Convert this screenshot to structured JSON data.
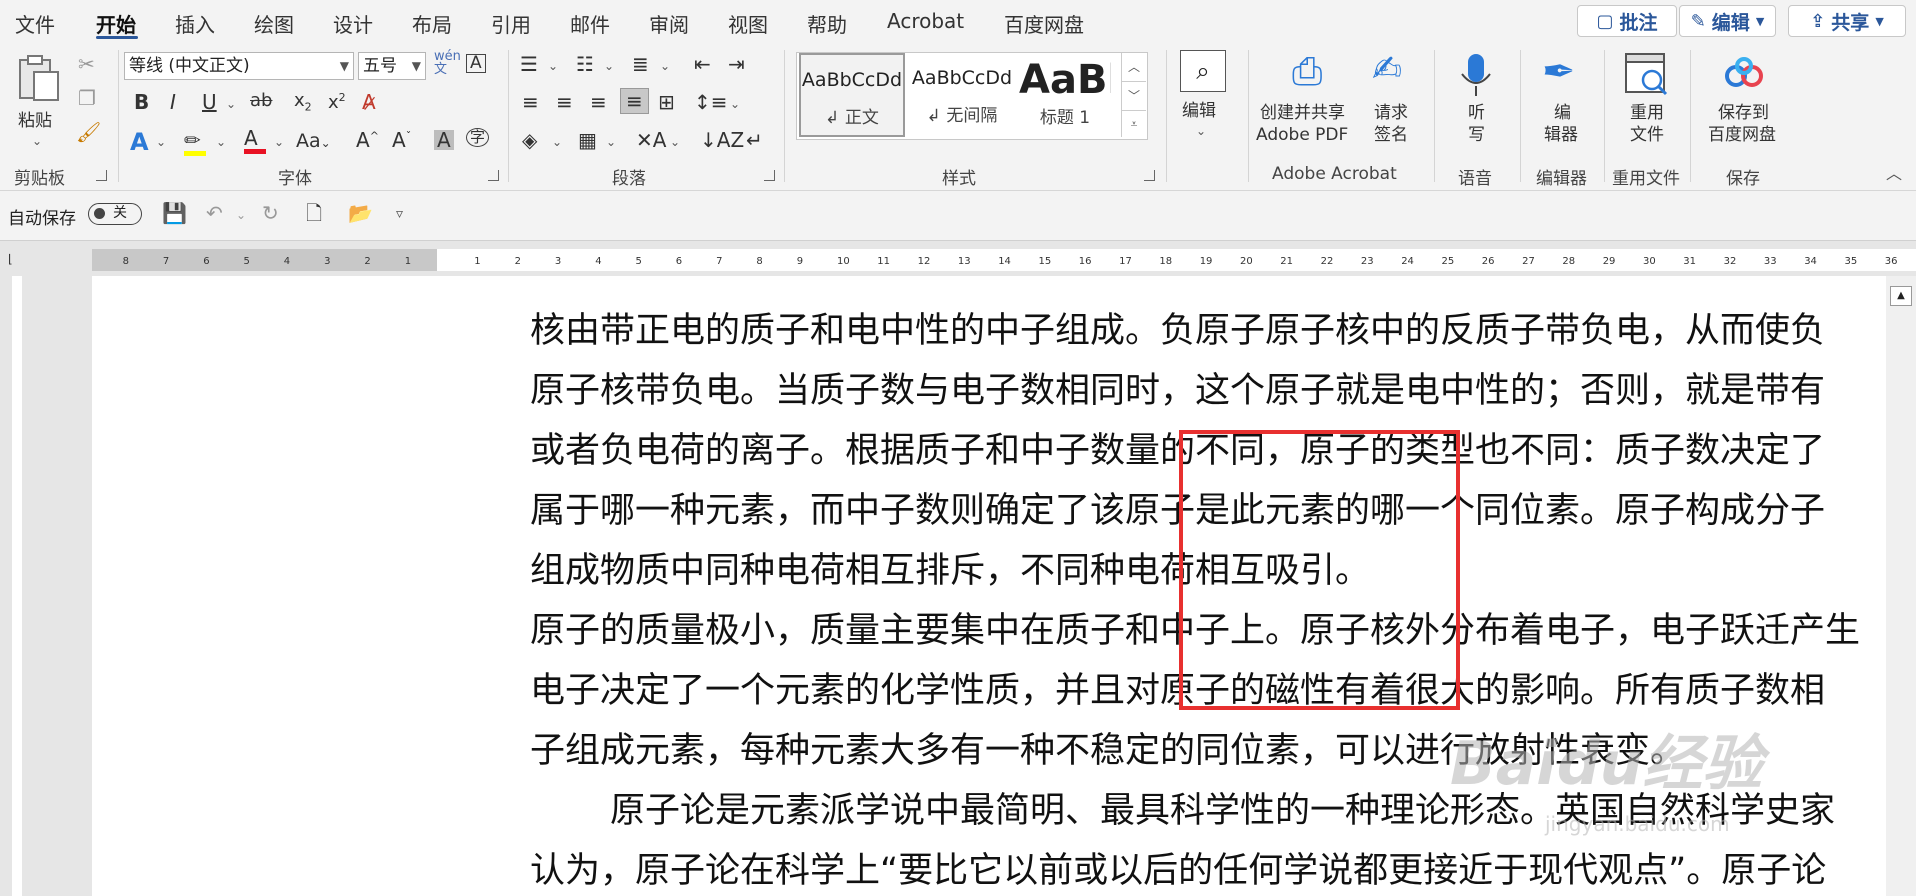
{
  "menu": {
    "items": [
      "文件",
      "开始",
      "插入",
      "绘图",
      "设计",
      "布局",
      "引用",
      "邮件",
      "审阅",
      "视图",
      "帮助",
      "Acrobat",
      "百度网盘"
    ],
    "active": "开始",
    "comment_label": "批注",
    "edit_label": "编辑",
    "share_label": "共享"
  },
  "ribbon": {
    "clipboard": {
      "paste_label": "粘贴",
      "group_label": "剪贴板"
    },
    "font": {
      "font_name": "等线 (中文正文)",
      "font_size": "五号",
      "group_label": "字体",
      "aa_label": "Aa"
    },
    "paragraph": {
      "group_label": "段落"
    },
    "styles": {
      "group_label": "样式",
      "items": [
        {
          "sample": "AaBbCcDd",
          "name": "↲ 正文"
        },
        {
          "sample": "AaBbCcDd",
          "name": "↲ 无间隔"
        },
        {
          "sample": "AaBb",
          "name": "标题 1"
        }
      ]
    },
    "editing": {
      "label": "编辑"
    },
    "acrobat": {
      "create_label_1": "创建并共享",
      "create_label_2": "Adobe PDF",
      "sign_label_1": "请求",
      "sign_label_2": "签名",
      "group_label": "Adobe Acrobat"
    },
    "voice": {
      "label_1": "听",
      "label_2": "写",
      "group_label": "语音"
    },
    "editor": {
      "label_1": "编",
      "label_2": "辑器",
      "group_label": "编辑器"
    },
    "reuse": {
      "label_1": "重用",
      "label_2": "文件",
      "group_label": "重用文件"
    },
    "save": {
      "label_1": "保存到",
      "label_2": "百度网盘",
      "group_label": "保存"
    }
  },
  "qat": {
    "autosave_label": "自动保存",
    "toggle_label": "关"
  },
  "ruler": {
    "left_ticks": [
      "8",
      "7",
      "6",
      "5",
      "4",
      "3",
      "2",
      "1"
    ],
    "right_ticks": [
      "1",
      "2",
      "3",
      "4",
      "5",
      "6",
      "7",
      "8",
      "9",
      "10",
      "11",
      "12",
      "13",
      "14",
      "15",
      "16",
      "17",
      "18",
      "19",
      "20",
      "21",
      "22",
      "23",
      "24",
      "25",
      "26",
      "27",
      "28",
      "29",
      "30",
      "31",
      "32",
      "33",
      "34",
      "35",
      "36"
    ]
  },
  "document": {
    "lines": [
      "核由带正电的质子和电中性的中子组成。负原子原子核中的反质子带负电，从而使负",
      "原子核带负电。当质子数与电子数相同时，这个原子就是电中性的；否则，就是带有",
      "或者负电荷的离子。根据质子和中子数量的不同，原子的类型也不同：质子数决定了",
      "属于哪一种元素，而中子数则确定了该原子是此元素的哪一个同位素。原子构成分子",
      "组成物质中同种电荷相互排斥，不同种电荷相互吸引。",
      "原子的质量极小，质量主要集中在质子和中子上。原子核外分布着电子，电子跃迁产生",
      "电子决定了一个元素的化学性质，并且对原子的磁性有着很大的影响。所有质子数相",
      "子组成元素，每种元素大多有一种不稳定的同位素，可以进行放射性衰变。",
      "原子论是元素派学说中最简明、最具科学性的一种理论形态。英国自然科学史家",
      "认为，原子论在科学上“要比它以前或以后的任何学说都更接近于现代观点”。原子论"
    ]
  },
  "watermark": {
    "text": "Baidu经验",
    "sub": "jingyan.baidu.com"
  }
}
